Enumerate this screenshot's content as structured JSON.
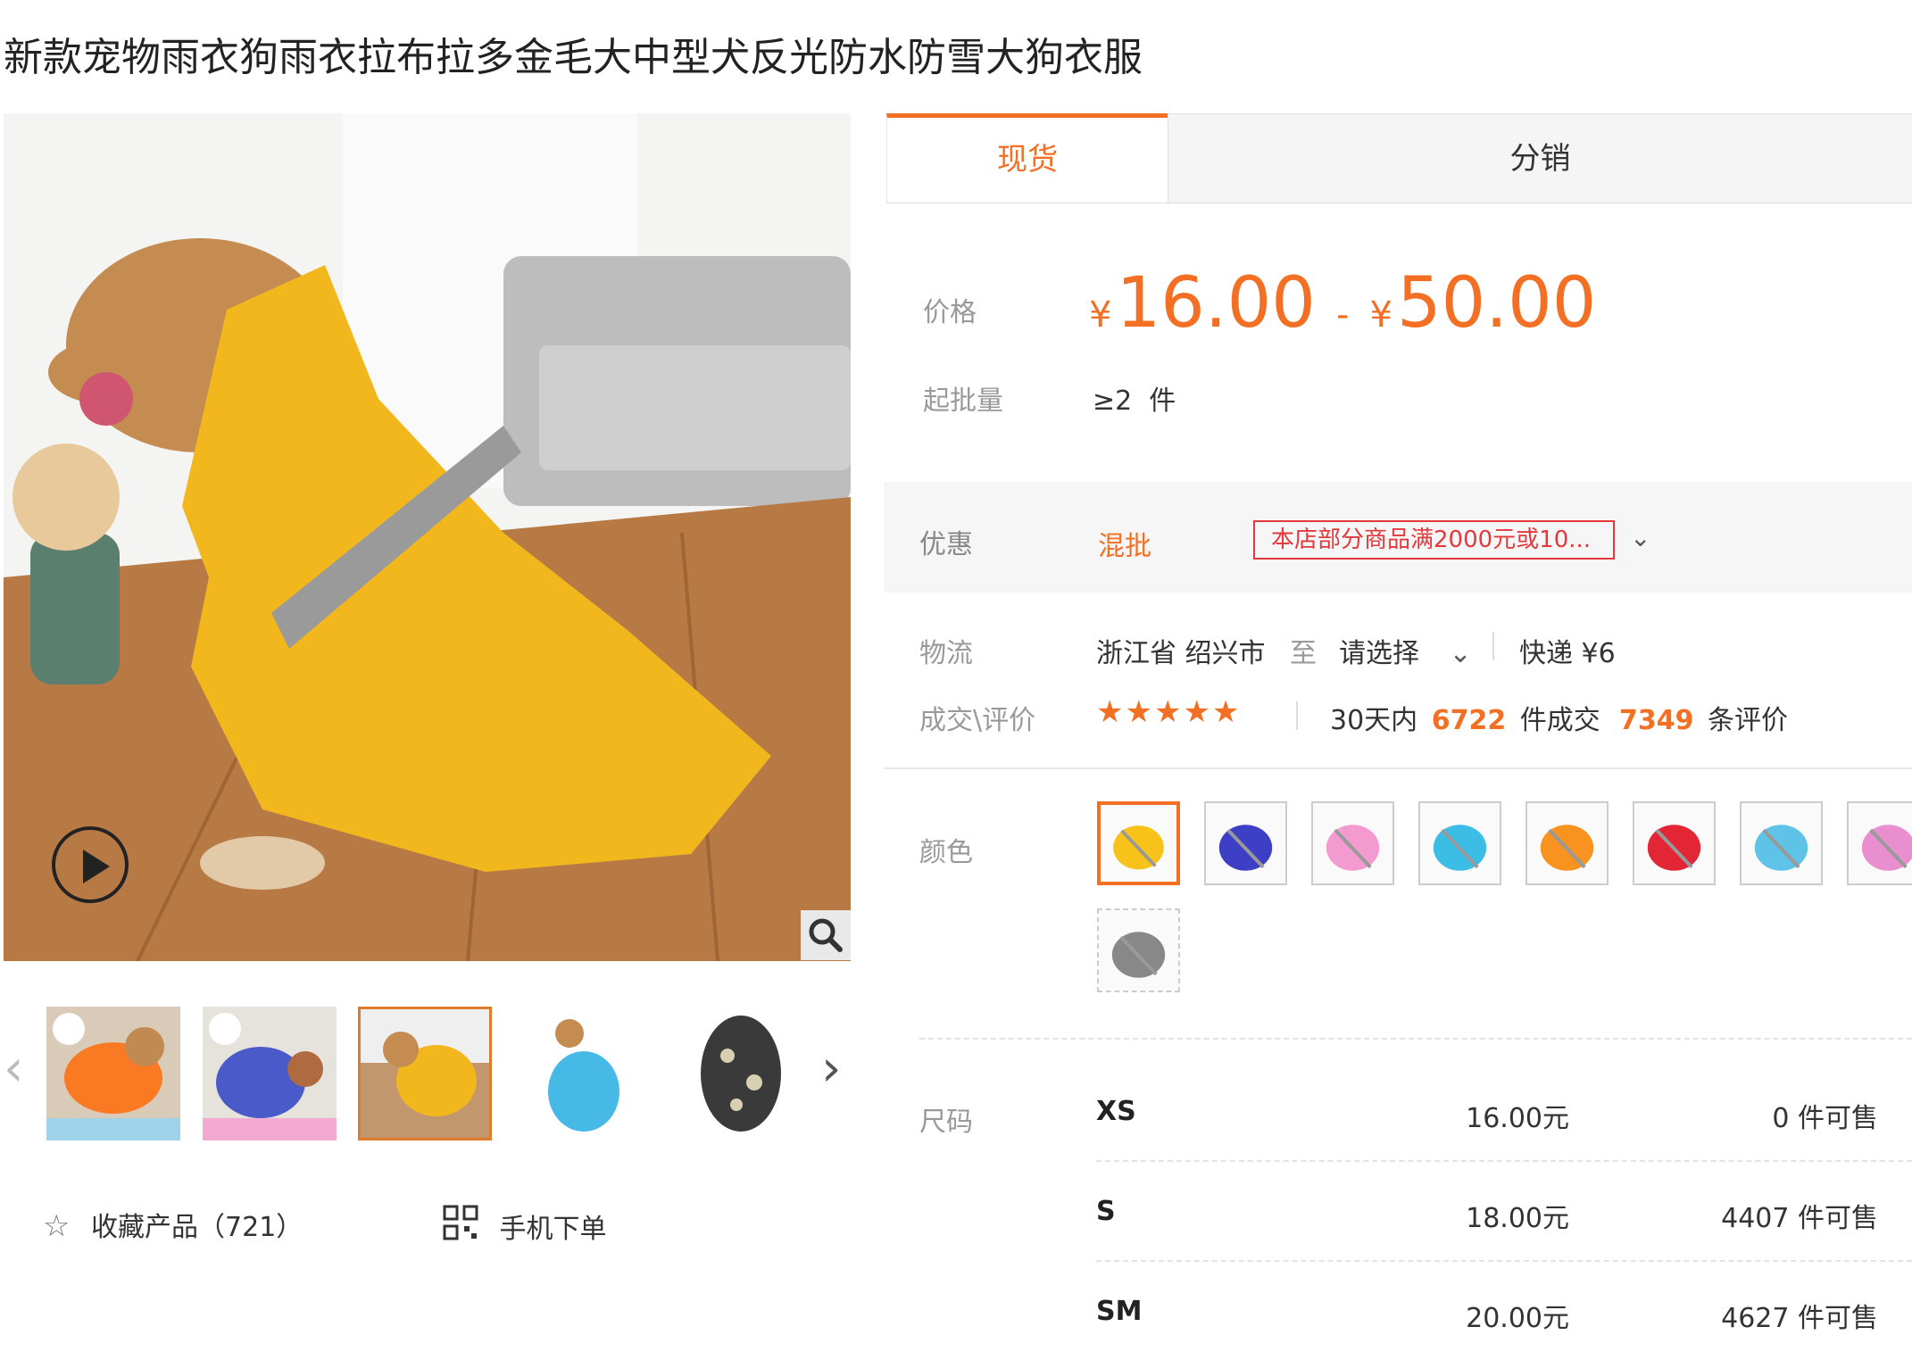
{
  "product": {
    "title": "新款宠物雨衣狗雨衣拉布拉多金毛大中型犬反光防水防雪大狗衣服"
  },
  "gallery": {
    "favorite_label": "收藏产品（721）",
    "mobile_order_label": "手机下单"
  },
  "tabs": [
    "现货",
    "分销"
  ],
  "price": {
    "label": "价格",
    "currency": "¥",
    "low": "16.00",
    "dash": "-",
    "high": "50.00"
  },
  "moq": {
    "label": "起批量",
    "value": "≥2  件"
  },
  "promo": {
    "label": "优惠",
    "type": "混批",
    "tag": "本店部分商品满2000元或10..."
  },
  "logistics": {
    "label": "物流",
    "origin": "浙江省 绍兴市",
    "to": "至",
    "select": "请选择",
    "shipping": "快递 ¥6"
  },
  "reviews": {
    "label": "成交\\评价",
    "stars": "★★★★★",
    "days": "30天内",
    "deals": "6722",
    "deals_unit": "件成交",
    "count": "7349",
    "count_unit": "条评价"
  },
  "colors": {
    "label": "颜色",
    "swatches": [
      "#f7c21a",
      "#3d3fc4",
      "#f39bd0",
      "#3bbde5",
      "#f7931e",
      "#e32636",
      "#5fc3e8",
      "#e98fcf",
      "#888888"
    ]
  },
  "sizes": {
    "label": "尺码",
    "rows": [
      {
        "name": "XS",
        "price": "16.00元",
        "stock": "0 件可售"
      },
      {
        "name": "S",
        "price": "18.00元",
        "stock": "4407 件可售"
      },
      {
        "name": "SM",
        "price": "20.00元",
        "stock": "4627 件可售"
      }
    ]
  },
  "theme": {
    "accent": "#f36f23",
    "promo_red": "#e4393c"
  }
}
